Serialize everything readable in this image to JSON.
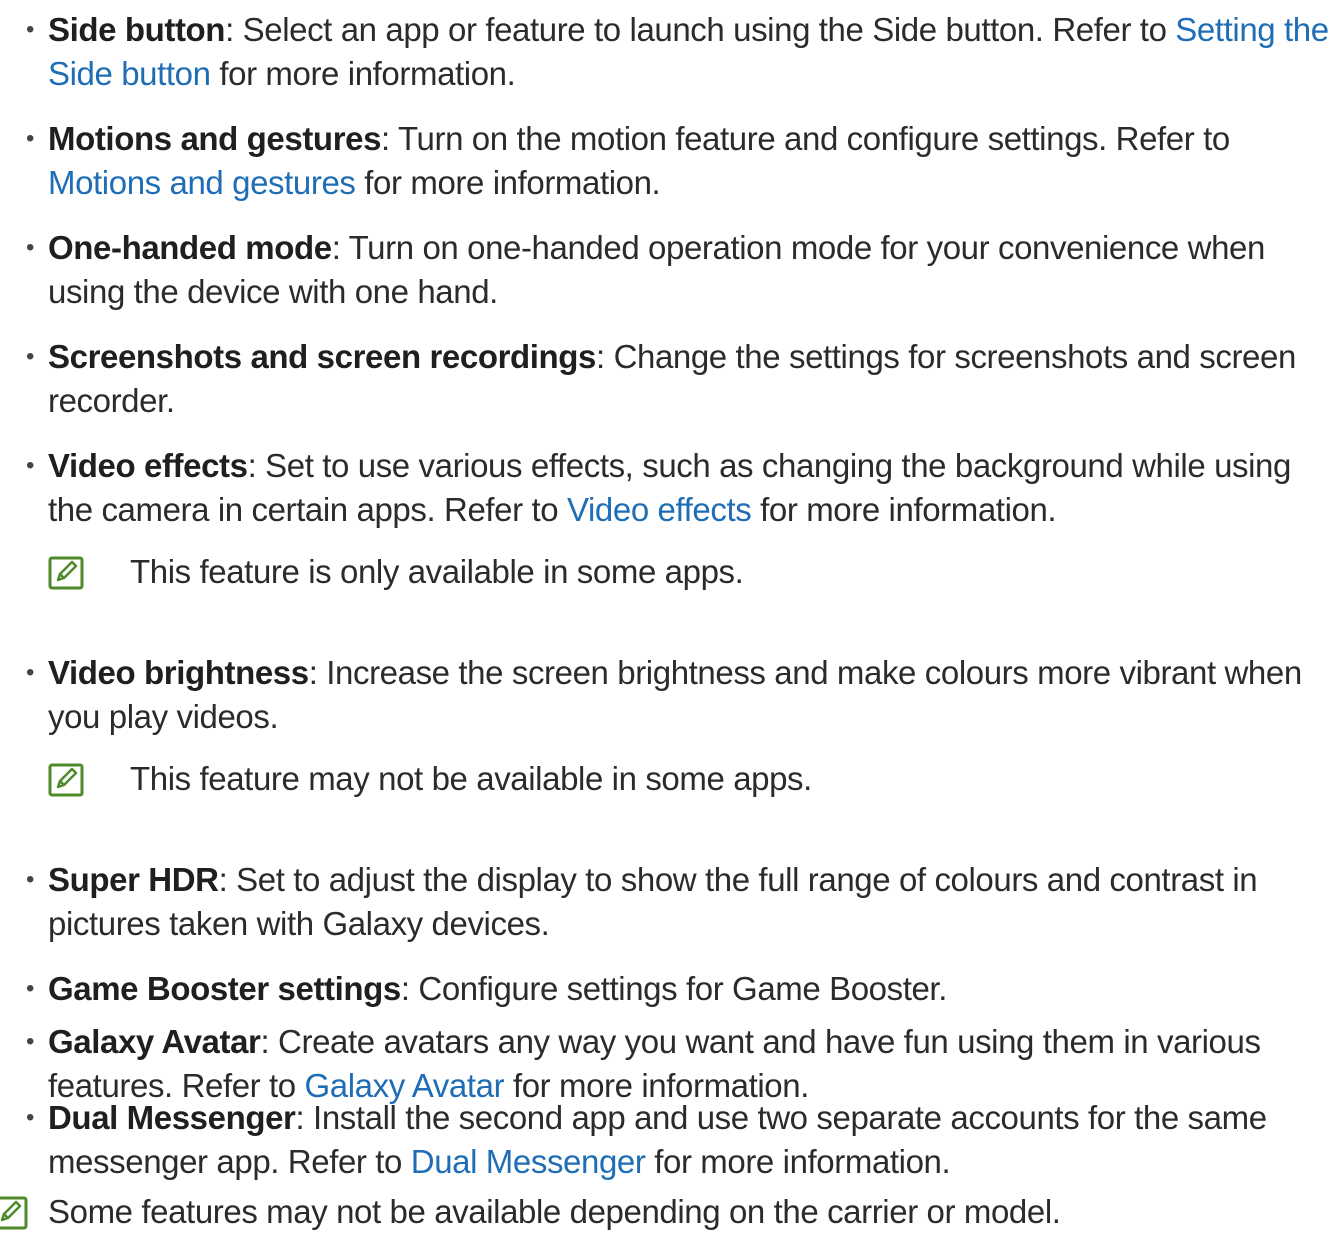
{
  "icons": {
    "note": "note-pencil-icon",
    "bullet": "•"
  },
  "colors": {
    "link": "#1f6eb5",
    "icon_stroke": "#4f8a2a",
    "text": "#2b2b2b"
  },
  "items": [
    {
      "term": "Side button",
      "sep": ": ",
      "pre": "Select an app or feature to launch using the Side button. Refer to ",
      "link": "Setting the Side button",
      "post": " for more information."
    },
    {
      "term": "Motions and gestures",
      "sep": ": ",
      "pre": "Turn on the motion feature and configure settings. Refer to ",
      "link": "Motions and gestures",
      "post": " for more information."
    },
    {
      "term": "One-handed mode",
      "sep": ": ",
      "pre": "Turn on one-handed operation mode for your convenience when using the device with one hand."
    },
    {
      "term": "Screenshots and screen recordings",
      "sep": ": ",
      "pre": "Change the settings for screenshots and screen recorder."
    },
    {
      "term": "Video effects",
      "sep": ": ",
      "pre": "Set to use various effects, such as changing the background while using the camera in certain apps. Refer to ",
      "link": "Video effects",
      "post": " for more information.",
      "note": "This feature is only available in some apps."
    },
    {
      "term": "Video brightness",
      "sep": ": ",
      "pre": "Increase the screen brightness and make colours more vibrant when you play videos.",
      "note": "This feature may not be available in some apps."
    },
    {
      "term": "Super HDR",
      "sep": ": ",
      "pre": "Set to adjust the display to show the full range of colours and contrast in pictures taken with Galaxy devices."
    },
    {
      "term": "Game Booster settings",
      "sep": ": ",
      "pre": "Configure settings for Game Booster."
    },
    {
      "term": "Galaxy Avatar",
      "sep": ": ",
      "pre": "Create avatars any way you want and have fun using them in various features. Refer to ",
      "link": "Galaxy Avatar",
      "post": " for more information."
    },
    {
      "term": "Dual Messenger",
      "sep": ": ",
      "pre": "Install the second app and use two separate accounts for the same messenger app. Refer to ",
      "link": "Dual Messenger",
      "post": " for more information."
    }
  ],
  "footer_note": "Some features may not be available depending on the carrier or model."
}
